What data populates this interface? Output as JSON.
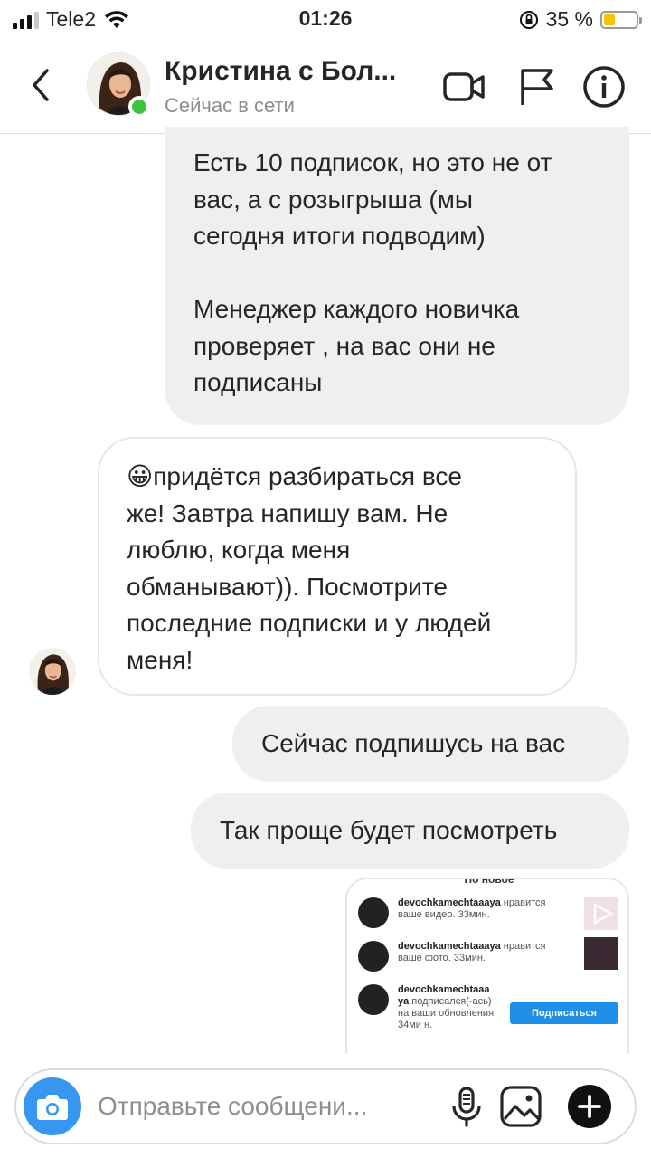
{
  "status_bar": {
    "carrier": "Tele2",
    "time": "01:26",
    "battery_percent": "35 %",
    "battery_level": 0.35,
    "icons": [
      "signal-icon",
      "wifi-icon",
      "orientation-lock-icon",
      "battery-icon"
    ]
  },
  "header": {
    "title": "Кристина с Бол...",
    "subtitle": "Сейчас в сети",
    "icons": [
      "back-icon",
      "video-call-icon",
      "flag-icon",
      "info-icon"
    ],
    "online_color": "#3ec53e"
  },
  "messages": [
    {
      "direction": "outgoing",
      "lines": [
        "Есть 10 подписок, но это не от",
        "вас, а с розыгрыша (мы",
        "сегодня итоги подводим)",
        "",
        "Менеджер каждого новичка",
        "проверяет , на вас они не",
        "подписаны"
      ]
    },
    {
      "direction": "incoming",
      "emoji": "😀",
      "lines": [
        "придётся разбираться все",
        "же! Завтра напишу вам. Не",
        "люблю, когда меня",
        "обманывают)). Посмотрите",
        "последние подписки и у людей",
        "меня!"
      ]
    },
    {
      "direction": "outgoing",
      "text": "Сейчас подпишусь на вас"
    },
    {
      "direction": "outgoing",
      "text": "Так проще будет посмотреть"
    }
  ],
  "attachment": {
    "header_text": "По новое",
    "rows": [
      {
        "user": "devochkamechtaaaya",
        "text": " нравится ваше видео. 33мин."
      },
      {
        "user": "devochkamechtaaaya",
        "text": " нравится ваше фото. 33мин."
      },
      {
        "user": "devochkamechtaaa ya",
        "text": " подписался(-ась) на ваши обновления. 34ми н."
      }
    ],
    "follow_button": "Подписаться",
    "button_color": "#1e8ee6"
  },
  "composer": {
    "placeholder": "Отправьте сообщени...",
    "icons": [
      "camera-icon",
      "microphone-icon",
      "gallery-icon",
      "plus-icon"
    ],
    "camera_color": "#3797f0"
  }
}
